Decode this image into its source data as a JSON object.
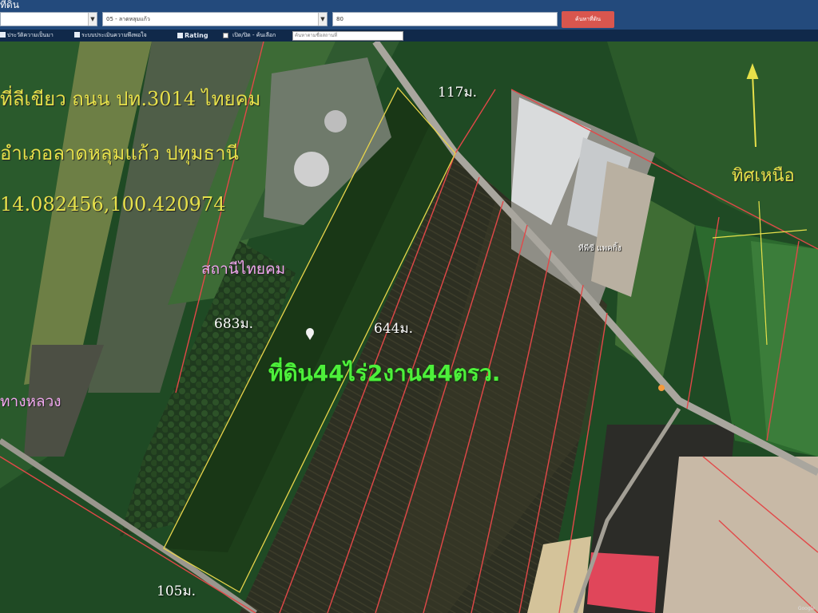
{
  "header": {
    "title": "ที่ดิน",
    "province_select": "",
    "district_select": "05 - ลาดหลุมแก้ว",
    "number_input": "80",
    "search_button": "ค้นหาที่ดิน"
  },
  "toolbar": {
    "items": [
      "ประวัติความเป็นมา",
      "ระบบประเมินความพึงพอใจ",
      "Rating",
      "เปิด/ปิด - ค้นเลือก"
    ],
    "search_placeholder": "ค้นหาตามชื่อสถานที่"
  },
  "map": {
    "annotations": {
      "location_line1": "ที่ลีเขียว ถนน ปท.3014 ไทยคม",
      "location_line2": "อำเภอลาดหลุมแก้ว ปทุมธานี",
      "coordinates": "14.082456,100.420974",
      "north_label": "ทิศเหนือ",
      "station_label": "สถานีไทยคม",
      "road_label": "ทางหลวง",
      "land_size": "ที่ดิน44ไร่2งาน44ตรว.",
      "factory_label": "ทีพีซี แพคกิ้ง"
    },
    "measurements": {
      "front": "117ม.",
      "left_side": "683ม.",
      "right_side": "644ม.",
      "bottom": "105ม."
    },
    "copyright": "Google"
  }
}
